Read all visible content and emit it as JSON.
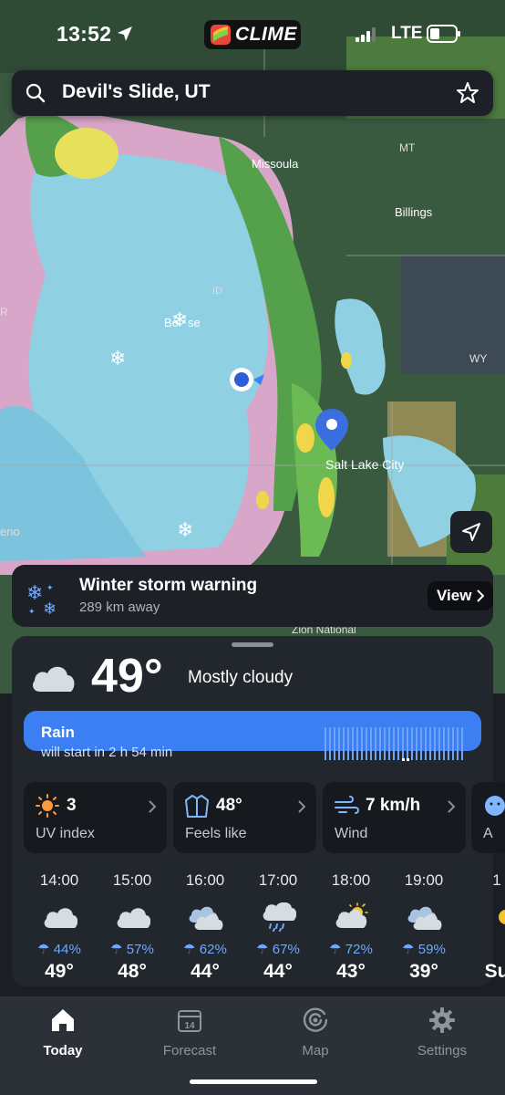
{
  "status": {
    "time": "13:52",
    "network": "LTE"
  },
  "brand": {
    "name": "CLIME"
  },
  "search": {
    "location": "Devil's Slide, UT"
  },
  "map": {
    "labels": {
      "missoula": "Missoula",
      "billings": "Billings",
      "mt": "MT",
      "wy": "WY",
      "id": "ID",
      "boise": "Bo",
      "boise2": "se",
      "slc": "Salt Lake City",
      "zion": "Zion National",
      "reno": "eno",
      "r": "R"
    },
    "colors": {
      "terrain": "#3a5a40",
      "rain": "#8fd0e3",
      "snow": "#d7a6c8",
      "heavy": "#f2d64a"
    }
  },
  "alert": {
    "title": "Winter storm warning",
    "distance": "289 km away",
    "button": "View"
  },
  "current": {
    "temperature": "49°",
    "condition": "Mostly cloudy"
  },
  "rain": {
    "title": "Rain",
    "subtitle": "will start in 2 h 54 min"
  },
  "tiles": [
    {
      "value": "3",
      "label": "UV index",
      "icon": "sun-icon"
    },
    {
      "value": "48°",
      "label": "Feels like",
      "icon": "jacket-icon"
    },
    {
      "value": "7 km/h",
      "label": "Wind",
      "icon": "wind-icon"
    },
    {
      "value": "",
      "label": "A",
      "icon": "face-icon"
    }
  ],
  "hourly": [
    {
      "time": "14:00",
      "precip": "44%",
      "temp": "49°",
      "icon": "cloud-icon"
    },
    {
      "time": "15:00",
      "precip": "57%",
      "temp": "48°",
      "icon": "cloud-icon"
    },
    {
      "time": "16:00",
      "precip": "62%",
      "temp": "44°",
      "icon": "clouds-icon"
    },
    {
      "time": "17:00",
      "precip": "67%",
      "temp": "44°",
      "icon": "rain-cloud-icon"
    },
    {
      "time": "18:00",
      "precip": "72%",
      "temp": "43°",
      "icon": "sun-cloud-icon"
    },
    {
      "time": "19:00",
      "precip": "59%",
      "temp": "39°",
      "icon": "clouds-icon"
    },
    {
      "time": "1",
      "precip": "",
      "temp": "Su",
      "icon": ""
    }
  ],
  "tabs": [
    {
      "label": "Today",
      "icon": "home-icon"
    },
    {
      "label": "Forecast",
      "icon": "calendar-icon"
    },
    {
      "label": "Map",
      "icon": "radar-icon"
    },
    {
      "label": "Settings",
      "icon": "gear-icon"
    }
  ]
}
